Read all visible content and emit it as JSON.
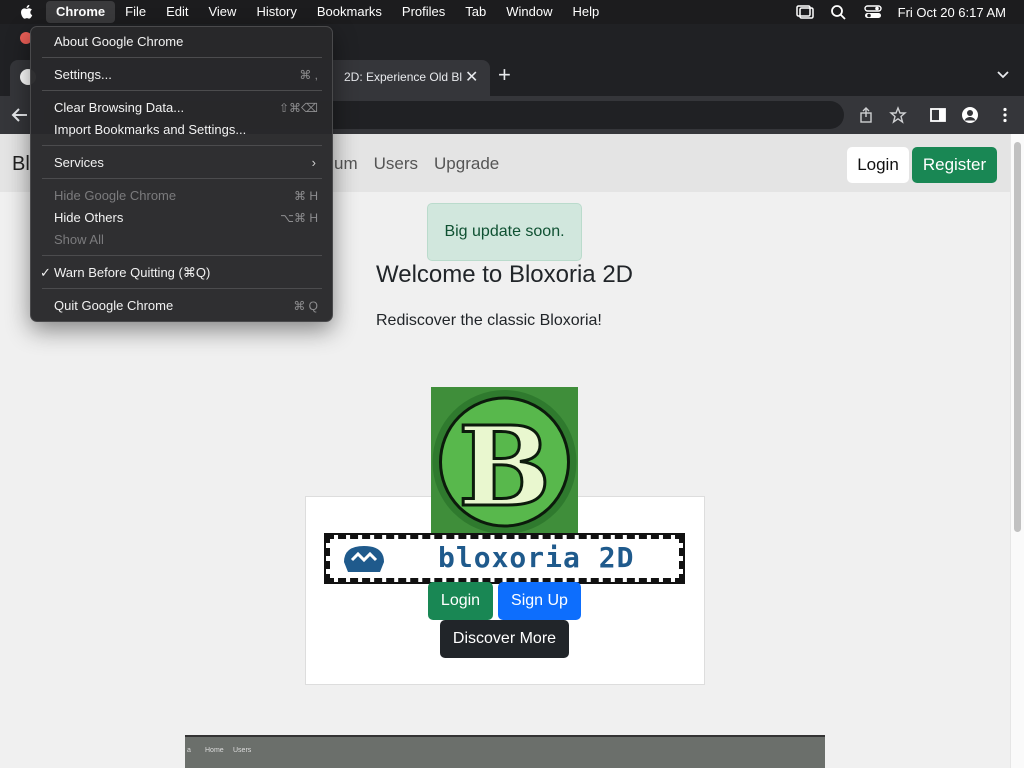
{
  "menubar": {
    "items": [
      "Chrome",
      "File",
      "Edit",
      "View",
      "History",
      "Bookmarks",
      "Profiles",
      "Tab",
      "Window",
      "Help"
    ],
    "active": "Chrome",
    "datetime": "Fri Oct 20  6:17 AM"
  },
  "dropdown": {
    "items": [
      {
        "label": "About Google Chrome",
        "shortcut": "",
        "enabled": true
      },
      {
        "label": "Settings...",
        "shortcut": "⌘ ,",
        "enabled": true
      },
      {
        "label": "Clear Browsing Data...",
        "shortcut": "⇧⌘⌫",
        "enabled": true
      },
      {
        "label": "Import Bookmarks and Settings...",
        "shortcut": "",
        "enabled": true
      },
      {
        "label": "Services",
        "shortcut": "",
        "enabled": true,
        "submenu": true
      },
      {
        "label": "Hide Google Chrome",
        "shortcut": "⌘ H",
        "enabled": false
      },
      {
        "label": "Hide Others",
        "shortcut": "⌥⌘ H",
        "enabled": true
      },
      {
        "label": "Show All",
        "shortcut": "",
        "enabled": false
      },
      {
        "label": "Warn Before Quitting (⌘Q)",
        "shortcut": "",
        "enabled": true,
        "checked": true
      },
      {
        "label": "Quit Google Chrome",
        "shortcut": "⌘ Q",
        "enabled": true
      }
    ],
    "checkmark": "✓",
    "submenu_arrow": "›"
  },
  "browser": {
    "tab_title": "2D: Experience Old Bl",
    "tab_close": "✕",
    "new_tab": "+"
  },
  "site": {
    "brand": "Bl",
    "nav_links": [
      "um",
      "Users",
      "Upgrade"
    ],
    "login_label": "Login",
    "register_label": "Register",
    "alert": "Big update soon.",
    "welcome_title": "Welcome to Bloxoria 2D",
    "tagline": "Rediscover the classic Bloxoria!",
    "logo_letter": "B",
    "banner_text": "bloxoria 2D",
    "card_buttons": {
      "login": "Login",
      "signup": "Sign Up",
      "discover": "Discover More"
    },
    "preview_labels": [
      "a",
      "Home",
      "Users"
    ]
  },
  "colors": {
    "success": "#198754",
    "primary": "#0d6efd",
    "dark": "#212529",
    "alert_bg": "#d1e7dd"
  }
}
